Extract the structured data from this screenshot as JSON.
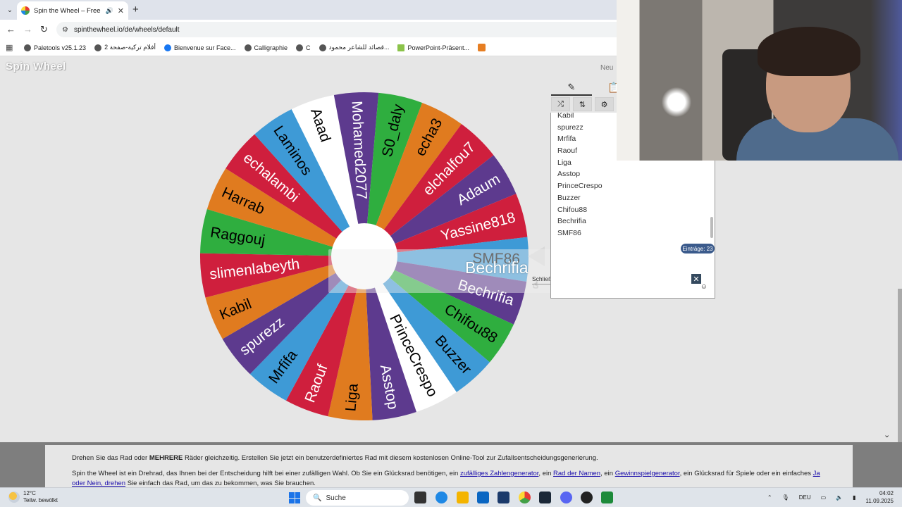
{
  "browser": {
    "tab_title": "Spin the Wheel – Free and e",
    "url": "spinthewheel.io/de/wheels/default",
    "bookmarks": [
      "Paletools v25.1.23",
      "أفلام تركية-صفحة 2",
      "Bienvenue sur Face...",
      "Calligraphie",
      "C",
      "قصائد للشاعر محمود...",
      "PowerPoint-Präsent..."
    ]
  },
  "header": {
    "logo_text": "Spin Wheel",
    "new_label": "Neu"
  },
  "wheel": {
    "segments": [
      {
        "name": "Aaad",
        "color": "#ffffff",
        "text_color": "#000000"
      },
      {
        "name": "Mohamed2077",
        "color": "#5d3a8e",
        "text_color": "#ffffff"
      },
      {
        "name": "S0_daly",
        "color": "#2fae3f",
        "text_color": "#000000"
      },
      {
        "name": "echa3",
        "color": "#e07b1f",
        "text_color": "#000000"
      },
      {
        "name": "elchalfou7",
        "color": "#cf1f3d",
        "text_color": "#ffffff"
      },
      {
        "name": "Adaum",
        "color": "#5d3a8e",
        "text_color": "#ffffff"
      },
      {
        "name": "Yassine818",
        "color": "#cf1f3d",
        "text_color": "#ffffff"
      },
      {
        "name": "SMF86",
        "color": "#3e9ad6",
        "text_color": "#000000"
      },
      {
        "name": "Bechrifia",
        "color": "#5d3a8e",
        "text_color": "#ffffff"
      },
      {
        "name": "Chifou88",
        "color": "#2fae3f",
        "text_color": "#000000"
      },
      {
        "name": "Buzzer",
        "color": "#3e9ad6",
        "text_color": "#000000"
      },
      {
        "name": "PrinceCrespo",
        "color": "#ffffff",
        "text_color": "#000000"
      },
      {
        "name": "Asstop",
        "color": "#5d3a8e",
        "text_color": "#ffffff"
      },
      {
        "name": "Liga",
        "color": "#e07b1f",
        "text_color": "#000000"
      },
      {
        "name": "Raouf",
        "color": "#cf1f3d",
        "text_color": "#ffffff"
      },
      {
        "name": "Mrfifa",
        "color": "#3e9ad6",
        "text_color": "#000000"
      },
      {
        "name": "spurezz",
        "color": "#5d3a8e",
        "text_color": "#ffffff"
      },
      {
        "name": "Kabil",
        "color": "#e07b1f",
        "text_color": "#000000"
      },
      {
        "name": "slimenlabeyth",
        "color": "#cf1f3d",
        "text_color": "#ffffff"
      },
      {
        "name": "Raggouj",
        "color": "#2fae3f",
        "text_color": "#000000"
      },
      {
        "name": "Harrab",
        "color": "#e07b1f",
        "text_color": "#000000"
      },
      {
        "name": "echalambi",
        "color": "#cf1f3d",
        "text_color": "#ffffff"
      },
      {
        "name": "Laminos",
        "color": "#3e9ad6",
        "text_color": "#000000"
      }
    ]
  },
  "entries": {
    "items": [
      "Kabil",
      "spurezz",
      "Mrfifa",
      "Raouf",
      "Liga",
      "Asstop",
      "PrinceCrespo",
      "Buzzer",
      "Chifou88",
      "Bechrifia",
      "SMF86"
    ],
    "count_label": "Einträge: 23"
  },
  "result": {
    "winner": "Bechrifia",
    "close_label": "Schließen"
  },
  "info": {
    "p1_pre": "Drehen Sie das Rad oder ",
    "p1_bold": "MEHRERE",
    "p1_post": " Räder gleichzeitig. Erstellen Sie jetzt ein benutzerdefiniertes Rad mit diesem kostenlosen Online-Tool zur Zufallsentscheidungsgenerierung.",
    "p2_a": "Spin the Wheel ist ein Drehrad, das Ihnen bei der Entscheidung hilft bei einer zufälligen Wahl. Ob Sie ein Glücksrad benötigen, ein ",
    "link1": "zufälliges Zahlengenerator",
    "p2_b": ", ein ",
    "link2": "Rad der Namen",
    "p2_c": ", ein ",
    "link3": "Gewinnspielgenerator",
    "p2_d": ", ein Glücksrad für Spiele oder ein einfaches ",
    "link4": "Ja oder Nein, drehen",
    "p2_e": " Sie einfach das Rad, um das zu bekommen, was Sie brauchen."
  },
  "taskbar": {
    "temperature": "12°C",
    "weather": "Teilw. bewölkt",
    "search_label": "Suche",
    "language": "DEU",
    "time": "04:02",
    "date": "11.09.2025"
  }
}
